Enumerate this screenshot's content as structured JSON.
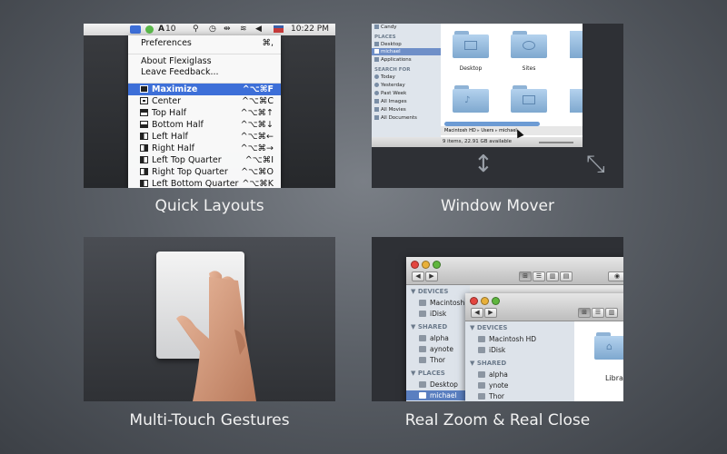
{
  "captions": {
    "quick_layouts": "Quick Layouts",
    "window_mover": "Window Mover",
    "multi_touch": "Multi-Touch Gestures",
    "real_zoom": "Real Zoom & Real Close"
  },
  "quick_layouts": {
    "menubar": {
      "battery": "10",
      "time": "10:22 PM"
    },
    "menu": {
      "preferences": {
        "label": "Preferences",
        "shortcut": "⌘,"
      },
      "about": "About Flexiglass",
      "feedback": "Leave Feedback...",
      "items": [
        {
          "label": "Maximize",
          "shortcut": "^⌥⌘F"
        },
        {
          "label": "Center",
          "shortcut": "^⌥⌘C"
        },
        {
          "label": "Top Half",
          "shortcut": "^⌥⌘↑"
        },
        {
          "label": "Bottom Half",
          "shortcut": "^⌥⌘↓"
        },
        {
          "label": "Left Half",
          "shortcut": "^⌥⌘←"
        },
        {
          "label": "Right Half",
          "shortcut": "^⌥⌘→"
        },
        {
          "label": "Left Top Quarter",
          "shortcut": "^⌥⌘I"
        },
        {
          "label": "Right Top Quarter",
          "shortcut": "^⌥⌘O"
        },
        {
          "label": "Left Bottom Quarter",
          "shortcut": "^⌥⌘K"
        }
      ]
    }
  },
  "window_mover": {
    "sidebar": {
      "top_item": "Candy",
      "places_header": "PLACES",
      "places": [
        "Desktop",
        "michael",
        "Applications"
      ],
      "search_header": "SEARCH FOR",
      "search": [
        "Today",
        "Yesterday",
        "Past Week",
        "All Images",
        "All Movies",
        "All Documents"
      ]
    },
    "folders": [
      "Desktop",
      "Sites"
    ],
    "path": [
      "Macintosh HD",
      "Users",
      "michael"
    ],
    "status": "9 items, 22.91 GB available"
  },
  "real_zoom": {
    "back_window": {
      "devices_header": "DEVICES",
      "devices": [
        "Macintosh HD",
        "iDisk"
      ],
      "shared_header": "SHARED",
      "shared": [
        "alpha",
        "aynote",
        "Thor"
      ],
      "places_header": "PLACES",
      "places": [
        "Desktop",
        "michael"
      ]
    },
    "front_window": {
      "devices_header": "DEVICES",
      "devices": [
        "Macintosh HD",
        "iDisk"
      ],
      "shared_header": "SHARED",
      "shared": [
        "alpha",
        "ynote",
        "Thor"
      ],
      "folder_label": "Libra"
    }
  }
}
